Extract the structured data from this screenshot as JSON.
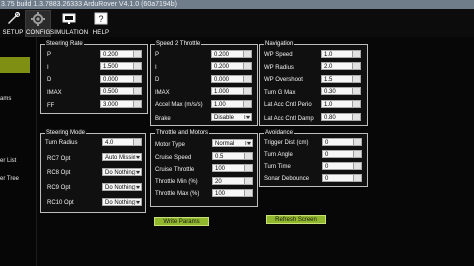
{
  "window": {
    "title": "3.75 build 1.3.7883.26333 ArduRover V4.1.0 (60a7194b)"
  },
  "toolbar": {
    "items": [
      {
        "label": "SETUP",
        "icon": "wrench-icon"
      },
      {
        "label": "CONFIG",
        "icon": "gear-icon"
      },
      {
        "label": "SIMULATION",
        "icon": "monitor-icon"
      },
      {
        "label": "HELP",
        "icon": "help-icon"
      }
    ]
  },
  "sidebar": {
    "items": [
      {
        "label": "ams"
      },
      {
        "label": "er List"
      },
      {
        "label": "er Tree"
      }
    ]
  },
  "groups": {
    "steering_rate": {
      "title": "Steering Rate",
      "rows": [
        {
          "label": "P",
          "value": "0.200"
        },
        {
          "label": "I",
          "value": "1.500"
        },
        {
          "label": "D",
          "value": "0.000"
        },
        {
          "label": "IMAX",
          "value": "0.500"
        },
        {
          "label": "FF",
          "value": "3.000"
        }
      ]
    },
    "speed2throttle": {
      "title": "Speed 2 Throttle",
      "rows": [
        {
          "label": "P",
          "value": "0.200"
        },
        {
          "label": "I",
          "value": "0.200"
        },
        {
          "label": "D",
          "value": "0.000"
        },
        {
          "label": "IMAX",
          "value": "1.000"
        },
        {
          "label": "Accel Max (m/s/s)",
          "value": "1.00"
        },
        {
          "label": "Brake",
          "value": "Disable"
        }
      ]
    },
    "navigation": {
      "title": "Navigation",
      "rows": [
        {
          "label": "WP Speed",
          "value": "1.0"
        },
        {
          "label": "WP Radius",
          "value": "2.0"
        },
        {
          "label": "WP Overshoot",
          "value": "1.5"
        },
        {
          "label": "Turn G Max",
          "value": "0.30"
        },
        {
          "label": "Lat Acc Cntl Perio",
          "value": "1.0"
        },
        {
          "label": "Lat Acc Cntl Damp",
          "value": "0.80"
        }
      ]
    },
    "steering_mode": {
      "title": "Steering Mode",
      "rows": [
        {
          "label": "Turn Radius",
          "value": "4.0"
        },
        {
          "label": "RC7 Opt",
          "value": "Auto Missio"
        },
        {
          "label": "RC8 Opt",
          "value": "Do Nothing"
        },
        {
          "label": "RC9 Opt",
          "value": "Do Nothing"
        },
        {
          "label": "RC10 Opt",
          "value": "Do Nothing"
        }
      ]
    },
    "throttle_motors": {
      "title": "Throttle and Motors",
      "rows": [
        {
          "label": "Motor Type",
          "value": "Normal"
        },
        {
          "label": "Cruise Speed",
          "value": "0.5"
        },
        {
          "label": "Cruise Throttle",
          "value": "100"
        },
        {
          "label": "Throttle Min (%)",
          "value": "20"
        },
        {
          "label": "Throttle Max (%)",
          "value": "100"
        }
      ]
    },
    "avoidance": {
      "title": "Avoidance",
      "rows": [
        {
          "label": "Trigger Dist (cm)",
          "value": "0"
        },
        {
          "label": "Turn Angle",
          "value": "0"
        },
        {
          "label": "Turn Time",
          "value": "0"
        },
        {
          "label": "Sonar Debounce",
          "value": "0"
        }
      ]
    }
  },
  "buttons": {
    "write_params": "Write Params",
    "refresh_screen": "Refresh Screen"
  },
  "colors": {
    "accent": "#91b72c",
    "sidebar_active": "#7f8f13",
    "titlebar": "#6f7c8a"
  }
}
